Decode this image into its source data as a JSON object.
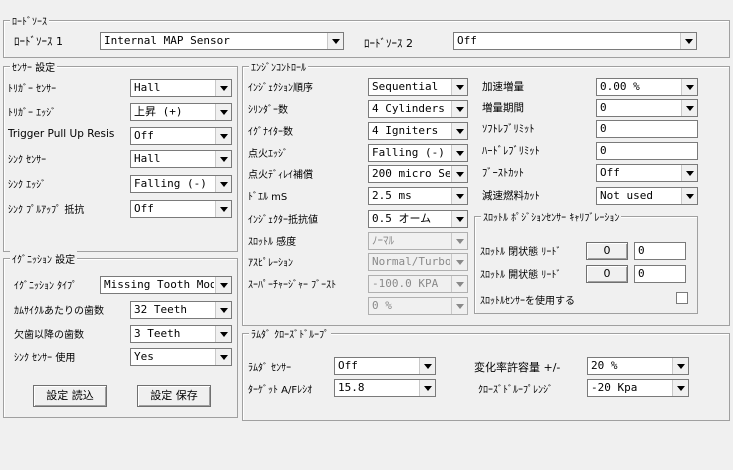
{
  "load_source": {
    "legend": "ﾛｰﾄﾞｿｰｽ",
    "source1_label": "ﾛｰﾄﾞｿｰｽ 1",
    "source1_value": "Internal MAP Sensor",
    "source2_label": "ﾛｰﾄﾞｿｰｽ 2",
    "source2_value": "Off"
  },
  "sensor": {
    "legend": "ｾﾝｻｰ 設定",
    "rows": [
      {
        "label": "ﾄﾘｶﾞｰ ｾﾝｻｰ",
        "value": "Hall"
      },
      {
        "label": "ﾄﾘｶﾞｰ ｴｯｼﾞ",
        "value": "上昇 (+)"
      },
      {
        "label": "Trigger Pull Up Resis",
        "value": "Off"
      },
      {
        "label": "ｼﾝｸ ｾﾝｻｰ",
        "value": "Hall"
      },
      {
        "label": "ｼﾝｸ ｴｯｼﾞ",
        "value": "Falling (-)"
      },
      {
        "label": "ｼﾝｸ ﾌﾟﾙｱｯﾌﾟ 抵抗",
        "value": "Off"
      }
    ]
  },
  "ignition": {
    "legend": "ｲｸﾞﾆｯｼｮﾝ 設定",
    "rows": [
      {
        "label": "ｲｸﾞﾆｯｼｮﾝ ﾀｲﾌﾟ",
        "value": "Missing Tooth Mode"
      },
      {
        "label": "ｶﾑｻｲｸﾙあたりの歯数",
        "value": "32 Teeth"
      },
      {
        "label": "欠歯以降の歯数",
        "value": "3 Teeth"
      },
      {
        "label": "ｼﾝｸ ｾﾝｻｰ 使用",
        "value": "Yes"
      }
    ],
    "read_button": "設定 読込",
    "save_button": "設定 保存"
  },
  "engine": {
    "legend": "ｴﾝｼﾞﾝｺﾝﾄﾛｰﾙ",
    "left_rows": [
      {
        "label": "ｲﾝｼﾞｪｸｼｮﾝ順序",
        "value": "Sequential",
        "disabled": false
      },
      {
        "label": "ｼﾘﾝﾀﾞｰ数",
        "value": "4 Cylinders",
        "disabled": false
      },
      {
        "label": "ｲｸﾞﾅｲﾀｰ数",
        "value": "4 Igniters",
        "disabled": false
      },
      {
        "label": "点火ｴｯｼﾞ",
        "value": "Falling (-)",
        "disabled": false
      },
      {
        "label": "点火ﾃﾞｨﾚｲ補償",
        "value": "200 micro Sec",
        "disabled": false
      },
      {
        "label": "ﾄﾞｴﾙ mS",
        "value": "2.5 ms",
        "disabled": false
      },
      {
        "label": "ｲﾝｼﾞｪｸﾀｰ抵抗値",
        "value": "0.5 オーム",
        "disabled": false
      },
      {
        "label": "ｽﾛｯﾄﾙ 感度",
        "value": "ﾉｰﾏﾙ",
        "disabled": true
      },
      {
        "label": "ｱｽﾋﾟﾚｰｼｮﾝ",
        "value": "Normal/Turbo",
        "disabled": true
      },
      {
        "label": "ｽｰﾊﾟｰﾁｬｰｼﾞｬｰ ﾌﾞｰｽﾄ",
        "value": "-100.0 KPA",
        "disabled": true
      },
      {
        "label": "",
        "value": "0 %",
        "disabled": true
      }
    ],
    "right_rows": [
      {
        "label": "加速増量",
        "value": "0.00 %",
        "type": "select"
      },
      {
        "label": "増量期間",
        "value": "0",
        "type": "select"
      },
      {
        "label": "ｿﾌﾄﾚﾌﾞﾘﾐｯﾄ",
        "value": "0",
        "type": "input"
      },
      {
        "label": "ﾊｰﾄﾞﾚﾌﾞﾘﾐｯﾄ",
        "value": "0",
        "type": "input"
      },
      {
        "label": "ﾌﾞｰｽﾄｶｯﾄ",
        "value": "Off",
        "type": "select"
      },
      {
        "label": "減速燃料ｶｯﾄ",
        "value": "Not used",
        "type": "select"
      }
    ]
  },
  "throttle_cal": {
    "legend": "ｽﾛｯﾄﾙ ﾎﾟｼﾞｼｮﾝｾﾝｻｰ ｷｬﾘﾌﾞﾚｰｼｮﾝ",
    "closed_label": "ｽﾛｯﾄﾙ 閉状態 ﾘｰﾄﾞ",
    "closed_button": "0",
    "closed_value": "0",
    "open_label": "ｽﾛｯﾄﾙ 開状態 ﾘｰﾄﾞ",
    "open_button": "0",
    "open_value": "0",
    "use_sensor_label": "ｽﾛｯﾄﾙｾﾝｻｰを使用する"
  },
  "lambda": {
    "legend": "ﾗﾑﾀﾞ ｸﾛｰｽﾞﾄﾞﾙｰﾌﾟ",
    "sensor_label": "ﾗﾑﾀﾞ ｾﾝｻｰ",
    "sensor_value": "Off",
    "target_label": "ﾀｰｹﾞｯﾄ A/Fﾚｼｵ",
    "target_value": "15.8",
    "tolerance_label": "変化率許容量 +/-",
    "tolerance_value": "20 %",
    "range_label": "ｸﾛｰｽﾞﾄﾞﾙｰﾌﾟﾚﾝｼﾞ",
    "range_value": "-20 Kpa"
  }
}
